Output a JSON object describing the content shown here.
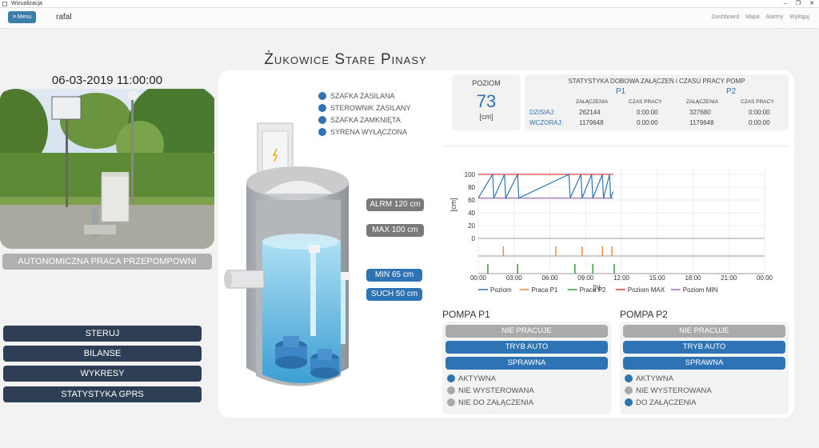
{
  "window": {
    "title": "Wizualizacja",
    "minimize": "–",
    "maximize": "❐",
    "close": "✕"
  },
  "nav": {
    "menu_label": "≡ Menu",
    "brand": "rafal",
    "links": [
      "Dashboard",
      "Mapa",
      "Alarmy",
      "Wyloguj"
    ]
  },
  "page": {
    "title": "Żukowice Stare Pinasy",
    "datetime": "06-03-2019 11:00:00"
  },
  "left": {
    "mode_button": "AUTONOMICZNA PRACA PRZEPOMPOWNI",
    "buttons": [
      "STERUJ",
      "BILANSE",
      "WYKRESY",
      "STATYSTYKA GPRS"
    ]
  },
  "status_items": [
    {
      "label": "Szafka zasilana",
      "color": "#2e74b5"
    },
    {
      "label": "Sterownik zasilany",
      "color": "#2e74b5"
    },
    {
      "label": "Szafka zamknięta",
      "color": "#2e74b5"
    },
    {
      "label": "Syrena wyłączona",
      "color": "#2e74b5"
    }
  ],
  "levels": {
    "alarm": "ALRM 120 cm",
    "max": "MAX 100 cm",
    "min": "MIN 65 cm",
    "dry": "SUCH 50 cm"
  },
  "colors": {
    "gray_label": "#7a7a7a",
    "blue_label": "#2e74b5",
    "navy": "#2e3e54",
    "accent": "#2e74b5"
  },
  "poziom": {
    "label": "POZIOM",
    "value": "73",
    "unit": "[cm]"
  },
  "stats": {
    "title": "STATYSTYKA DOBOWA ZAŁĄCZEŃ i CZASU PRACY POMP",
    "p1": "P1",
    "p2": "P2",
    "col_zal": "ZAŁĄCZENIA",
    "col_czas": "CZAS PRACY",
    "rows": [
      {
        "label": "DZISIAJ:",
        "p1_zal": "262144",
        "p1_czas": "0:00:00",
        "p2_zal": "327680",
        "p2_czas": "0:00:00"
      },
      {
        "label": "WCZORAJ:",
        "p1_zal": "1179648",
        "p1_czas": "0:00:00",
        "p2_zal": "1179648",
        "p2_czas": "0:00:00"
      }
    ]
  },
  "chart_data": {
    "type": "line",
    "ylabel": "[cm]",
    "xlabel": "[h]",
    "y_ticks": [
      0,
      20,
      40,
      60,
      80,
      100
    ],
    "x_ticks": [
      "00:00",
      "03:00",
      "06:00",
      "09:00",
      "12:00",
      "15:00",
      "18:00",
      "21:00",
      "00:00"
    ],
    "x_range_hours": [
      0,
      24
    ],
    "y_range": [
      0,
      105
    ],
    "grid": true,
    "legend_position": "bottom",
    "series": [
      {
        "name": "Poziom",
        "color": "#2e74b5",
        "x": [
          0,
          1.2,
          1.3,
          2.2,
          2.3,
          3.3,
          3.4,
          7.6,
          7.7,
          8.6,
          8.7,
          9.5,
          9.6,
          10.4,
          10.5,
          11,
          11.1,
          11.3
        ],
        "y": [
          63,
          100,
          63,
          100,
          63,
          100,
          63,
          100,
          63,
          100,
          63,
          100,
          63,
          100,
          63,
          100,
          63,
          73
        ]
      },
      {
        "name": "Praca P1",
        "color": "#f28c38",
        "pulses": [
          2.1,
          6.5,
          8.7,
          10.4,
          11.2
        ]
      },
      {
        "name": "Praca P2",
        "color": "#3a9a3a",
        "pulses": [
          0.8,
          3.3,
          8.1,
          9.6,
          11.4
        ]
      },
      {
        "name": "Poziom MAX",
        "color": "#e03c3c",
        "value": 100
      },
      {
        "name": "Poziom MIN",
        "color": "#9b6fb0",
        "value": 63
      }
    ]
  },
  "pumps": [
    {
      "title": "POMPA P1",
      "btn1": "NIE PRACUJE",
      "btn2": "TRYB AUTO",
      "btn3": "SPRAWNA",
      "states": [
        {
          "label": "AKTYWNA",
          "color": "#2e74b5"
        },
        {
          "label": "NIE WYSTEROWANA",
          "color": "#aaaaaa"
        },
        {
          "label": "NIE DO ZAŁĄCZENIA",
          "color": "#aaaaaa"
        }
      ]
    },
    {
      "title": "POMPA P2",
      "btn1": "NIE PRACUJE",
      "btn2": "TRYB AUTO",
      "btn3": "SPRAWNA",
      "states": [
        {
          "label": "AKTYWNA",
          "color": "#2e74b5"
        },
        {
          "label": "NIE WYSTEROWANA",
          "color": "#aaaaaa"
        },
        {
          "label": "DO ZAŁĄCZENIA",
          "color": "#2e74b5"
        }
      ]
    }
  ]
}
